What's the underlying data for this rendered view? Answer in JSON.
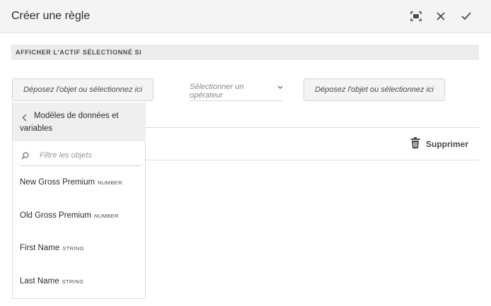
{
  "dialog": {
    "title": "Créer une règle"
  },
  "header_icons": {
    "fullscreen": "fullscreen-icon",
    "close": "close-icon",
    "confirm": "checkmark-icon"
  },
  "section": {
    "label": "AFFICHER L'ACTIF SÉLECTIONNÉ SI"
  },
  "condition": {
    "left_operand": "Déposez l'objet ou sélectionnez ici",
    "operator_placeholder": "Sélectionner un opérateur",
    "right_operand": "Déposez l'objet ou sélectionnez ici"
  },
  "actions": {
    "delete_label": "Supprimer"
  },
  "object_panel": {
    "title": "Modèles de données et variables",
    "search_placeholder": "Filtre les objets",
    "items": [
      {
        "name": "New Gross Premium",
        "type": "NUMBER"
      },
      {
        "name": "Old Gross Premium",
        "type": "NUMBER"
      },
      {
        "name": "First Name",
        "type": "STRING"
      },
      {
        "name": "Last Name",
        "type": "STRING"
      }
    ]
  },
  "colors": {
    "header_bg": "#f4f4f4",
    "section_bg": "#ececec",
    "text": "#2c2c2c",
    "muted": "#8a8a8a"
  }
}
